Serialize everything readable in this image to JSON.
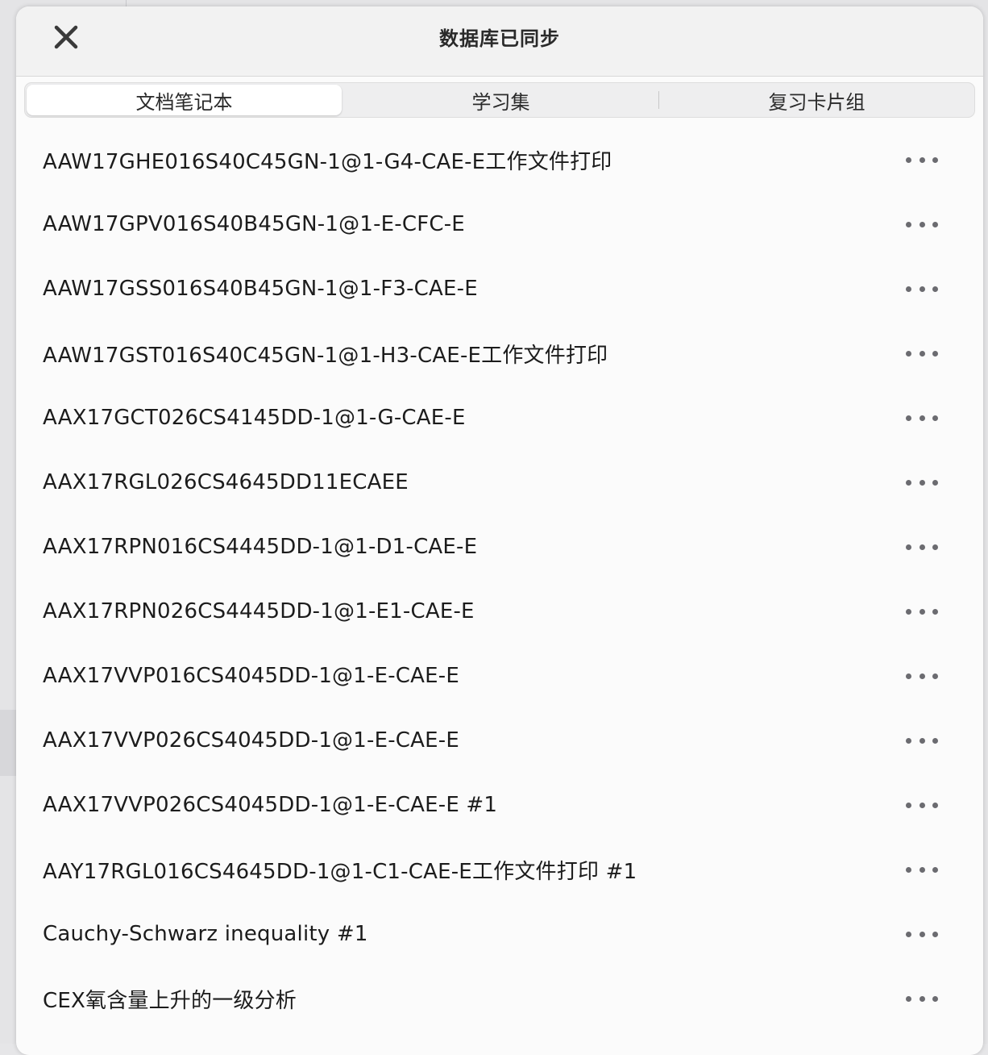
{
  "header": {
    "title": "数据库已同步",
    "close_icon": "close-icon"
  },
  "tabs": [
    {
      "label": "文档笔记本",
      "selected": true
    },
    {
      "label": "学习集",
      "selected": false
    },
    {
      "label": "复习卡片组",
      "selected": false
    }
  ],
  "items": [
    {
      "label": "AAW17GHE016S40C45GN-1@1-G4-CAE-E工作文件打印"
    },
    {
      "label": "AAW17GPV016S40B45GN-1@1-E-CFC-E"
    },
    {
      "label": "AAW17GSS016S40B45GN-1@1-F3-CAE-E"
    },
    {
      "label": "AAW17GST016S40C45GN-1@1-H3-CAE-E工作文件打印"
    },
    {
      "label": "AAX17GCT026CS4145DD-1@1-G-CAE-E"
    },
    {
      "label": "AAX17RGL026CS4645DD11ECAEE"
    },
    {
      "label": "AAX17RPN016CS4445DD-1@1-D1-CAE-E"
    },
    {
      "label": "AAX17RPN026CS4445DD-1@1-E1-CAE-E"
    },
    {
      "label": "AAX17VVP016CS4045DD-1@1-E-CAE-E"
    },
    {
      "label": "AAX17VVP026CS4045DD-1@1-E-CAE-E"
    },
    {
      "label": "AAX17VVP026CS4045DD-1@1-E-CAE-E #1"
    },
    {
      "label": "AAY17RGL016CS4645DD-1@1-C1-CAE-E工作文件打印 #1"
    },
    {
      "label": "Cauchy-Schwarz inequality #1"
    },
    {
      "label": "CEX氧含量上升的一级分析"
    }
  ],
  "more_icon": "more-horizontal-icon",
  "colors": {
    "sheet_bg": "#fbfbfb",
    "header_bg": "#f2f2f2",
    "text": "#1c1c1c",
    "icon": "#6b6b70"
  }
}
